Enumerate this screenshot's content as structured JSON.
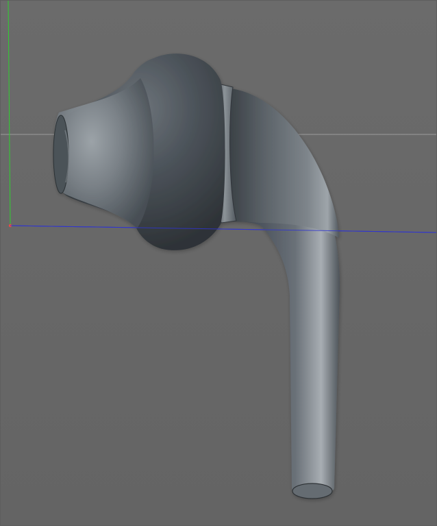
{
  "viewport": {
    "background_color": "#686868",
    "horizon_line_color": "#9a9a9a",
    "y_axis_color": "#2fd12f",
    "x_axis_color": "#2b2bd6",
    "origin_color": "#e84a4a"
  },
  "model": {
    "base_color": "#5a6066",
    "highlight_color": "#a7adb2",
    "shadow_color": "#2d3236"
  },
  "icons": {
    "world_axes": "axes-gizmo",
    "mesh": "earbud-mesh"
  }
}
